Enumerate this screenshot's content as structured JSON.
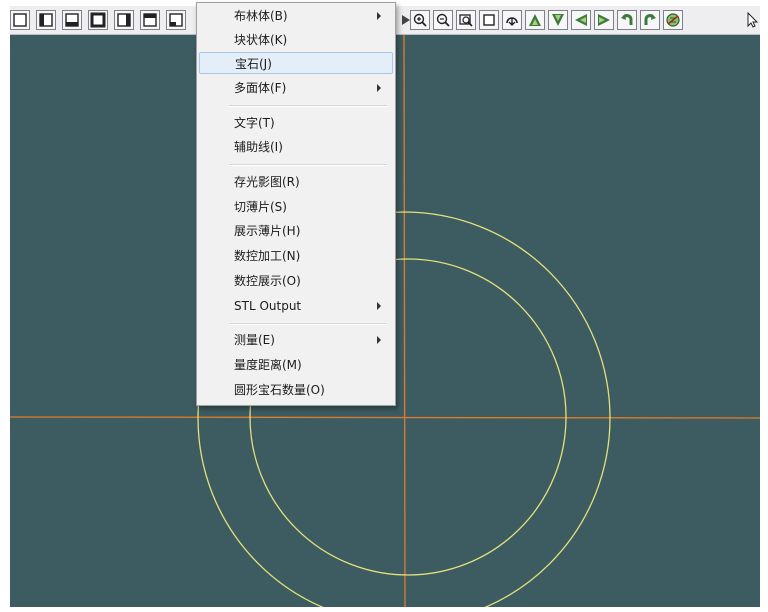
{
  "toolbar": {
    "left_icons": [
      "view-top-icon",
      "view-front-icon",
      "view-bottom-icon",
      "view-back-icon",
      "view-right-icon",
      "view-left-icon",
      "view-iso-icon"
    ],
    "right_icons": [
      "arrow-right-icon",
      "zoom-in-icon",
      "zoom-out-icon",
      "zoom-window-icon",
      "zoom-fit-icon",
      "rotate-view-icon",
      "rotate-up-icon",
      "rotate-down-icon",
      "rotate-left-icon",
      "rotate-right-icon",
      "rotate-ccw-icon",
      "rotate-cw-icon",
      "render-icon",
      "select-pointer-icon"
    ]
  },
  "menu": {
    "items": [
      {
        "label": "布林体(B)",
        "submenu": true
      },
      {
        "label": "块状体(K)",
        "submenu": false
      },
      {
        "label": "宝石(J)",
        "submenu": false,
        "highlighted": true
      },
      {
        "label": "多面体(F)",
        "submenu": true
      },
      {
        "label": "文字(T)",
        "submenu": false
      },
      {
        "label": "辅助线(I)",
        "submenu": false
      },
      {
        "label": "存光影图(R)",
        "submenu": false
      },
      {
        "label": "切薄片(S)",
        "submenu": false
      },
      {
        "label": "展示薄片(H)",
        "submenu": false
      },
      {
        "label": "数控加工(N)",
        "submenu": false
      },
      {
        "label": "数控展示(O)",
        "submenu": false
      },
      {
        "label": "STL Output",
        "submenu": true
      },
      {
        "label": "测量(E)",
        "submenu": true
      },
      {
        "label": "量度距离(M)",
        "submenu": false
      },
      {
        "label": "圆形宝石数量(O)",
        "submenu": false
      }
    ]
  },
  "colors": {
    "viewport_bg": "#3d5c61",
    "axis_line": "#e07b2a",
    "circle_line": "#e4e07a",
    "menu_bg": "#f1f1f1",
    "menu_highlight": "#e4eef9"
  }
}
